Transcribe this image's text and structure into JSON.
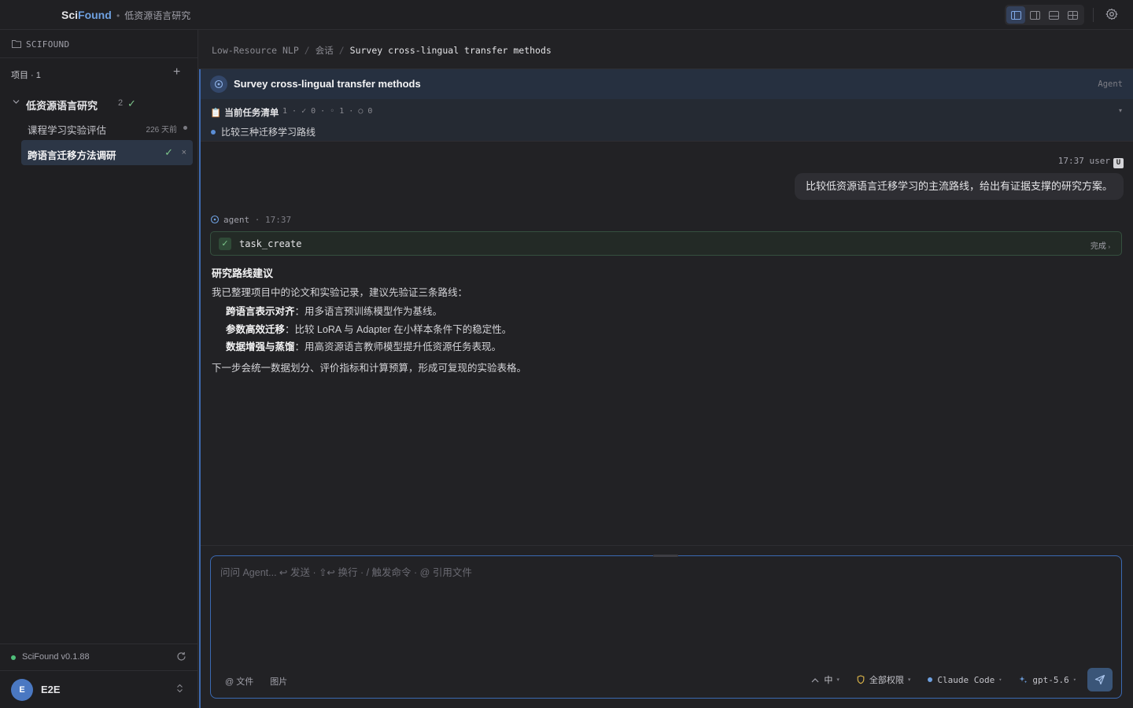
{
  "app": {
    "brand_sci": "Sci",
    "brand_found": "Found",
    "current_project": "低资源语言研究"
  },
  "sidebar": {
    "workspace_label": "SCIFOUND",
    "projects_header": "项目 · 1",
    "group": {
      "name": "低资源语言研究",
      "count": "2",
      "status": "✓"
    },
    "sessions": [
      {
        "title": "课程学习实验评估",
        "meta": "226 天前",
        "active": false
      },
      {
        "title": "跨语言迁移方法调研",
        "meta": "✓",
        "close": "×",
        "active": true
      }
    ],
    "version": "SciFound v0.1.88",
    "user": {
      "initial": "E",
      "name": "E2E"
    }
  },
  "breadcrumb": {
    "project": "Low-Resource NLP",
    "section": "会话",
    "current": "Survey cross-lingual transfer methods"
  },
  "session": {
    "title": "Survey cross-lingual transfer methods",
    "role": "Agent"
  },
  "tasks": {
    "header": "当前任务清单",
    "stats": "1 · ✓ 0 · ◦ 1 · ○ 0",
    "items": [
      "比较三种迁移学习路线"
    ]
  },
  "messages": {
    "user": {
      "time": "17:37",
      "who": "user",
      "badge": "U",
      "text": "比较低资源语言迁移学习的主流路线，给出有证据支撑的研究方案。"
    },
    "agent": {
      "who": "agent",
      "time": "17:37",
      "tool_name": "task_create",
      "tool_status": "完成",
      "heading": "研究路线建议",
      "intro": "我已整理项目中的论文和实验记录，建议先验证三条路线：",
      "points": [
        {
          "bold": "跨语言表示对齐",
          "text": "：用多语言预训练模型作为基线。"
        },
        {
          "bold": "参数高效迁移",
          "text": "：比较 LoRA 与 Adapter 在小样本条件下的稳定性。"
        },
        {
          "bold": "数据增强与蒸馏",
          "text": "：用高资源语言教师模型提升低资源任务表现。"
        }
      ],
      "outro": "下一步会统一数据划分、评价指标和计算预算，形成可复现的实验表格。"
    }
  },
  "composer": {
    "placeholder": "问问 Agent... ↩ 发送 · ⇧↩ 换行 · / 触发命令 · @ 引用文件",
    "file_label": "@ 文件",
    "image_label": "图片",
    "effort": "中",
    "permission": "全部权限",
    "agent": "Claude Code",
    "model": "gpt-5.6"
  },
  "colors": {
    "accent": "#3b6ab3",
    "success": "#7cc48a",
    "avatar": "#4a78c2"
  }
}
